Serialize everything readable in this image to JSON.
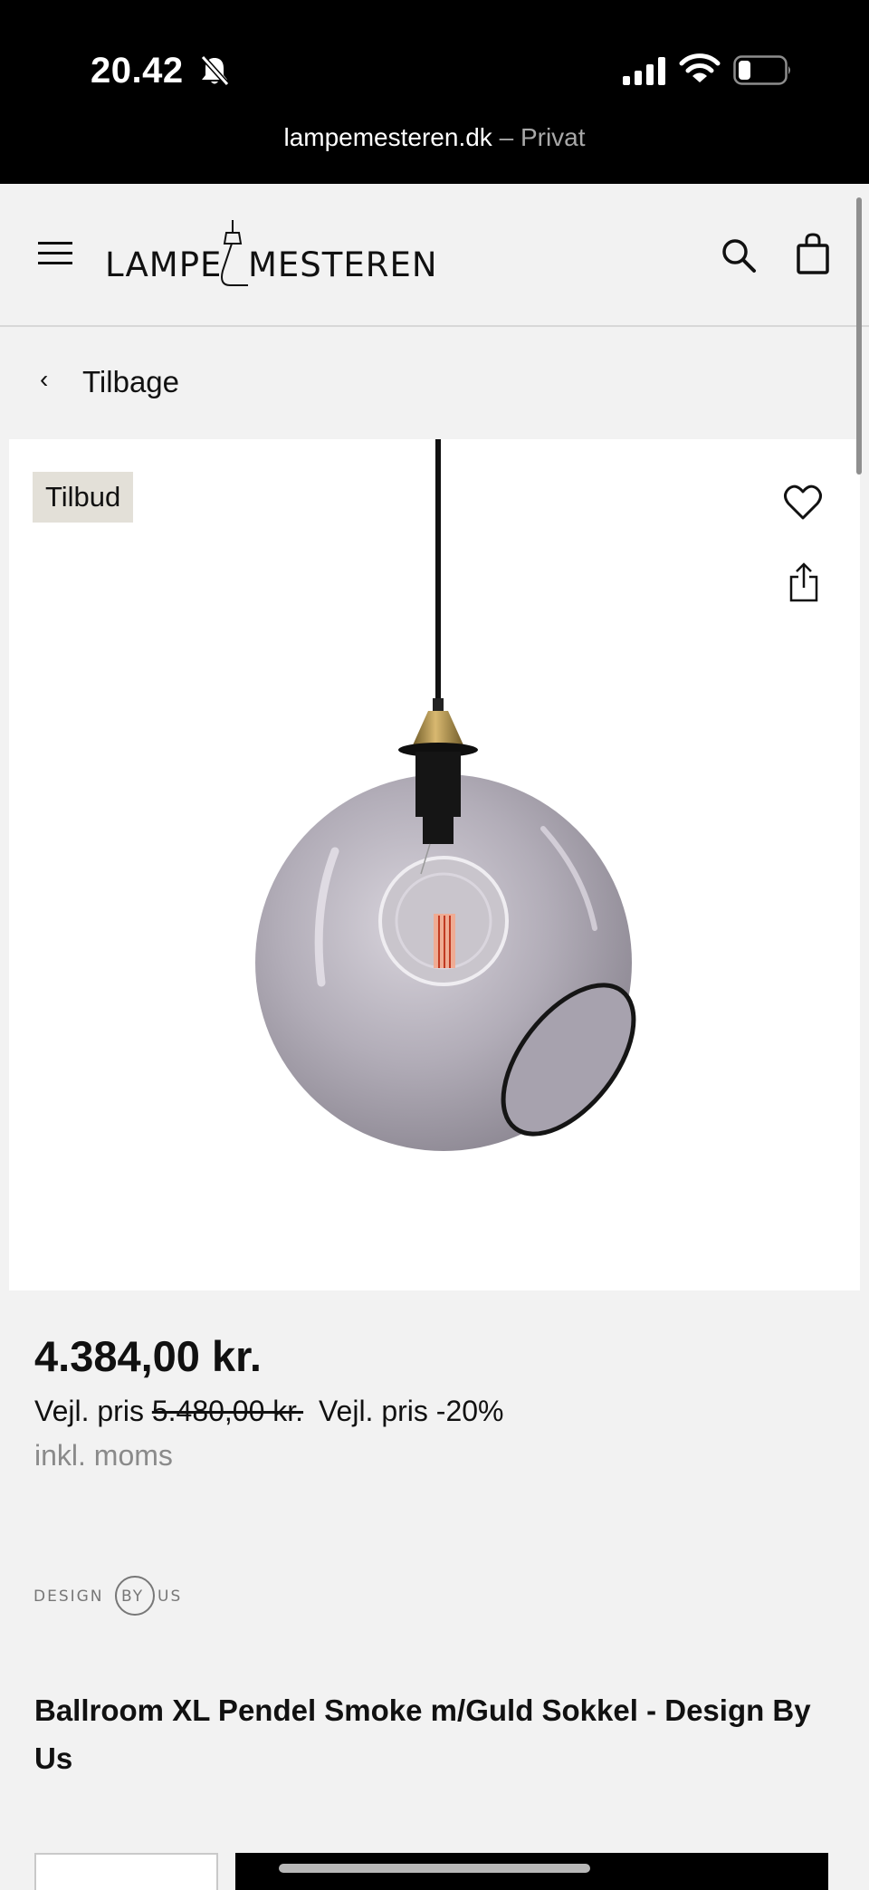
{
  "status_bar": {
    "time": "20.42",
    "icons": [
      "bell-slash-icon",
      "signal-icon",
      "wifi-icon",
      "battery-icon"
    ]
  },
  "browser": {
    "domain": "lampemesteren.dk",
    "mode": "– Privat"
  },
  "header": {
    "logo_left": "LAMPE",
    "logo_right": "MESTEREN",
    "icons": [
      "menu-icon",
      "search-icon",
      "bag-icon"
    ]
  },
  "back": {
    "label": "Tilbage",
    "icon": "chevron-left-icon"
  },
  "product": {
    "badge": "Tilbud",
    "price": "4.384,00 kr.",
    "rrp_label": "Vejl. pris",
    "rrp_value": "5.480,00 kr.",
    "discount": "Vejl. pris -20%",
    "vat_note": "inkl. moms",
    "brand_logo_text": "DESIGN BY US",
    "title": "Ballroom XL Pendel Smoke m/Guld Sokkel - Design By Us",
    "image_icons": [
      "heart-icon",
      "share-icon"
    ]
  },
  "colors": {
    "background": "#f2f2f2",
    "topbar": "#000000",
    "badge_bg": "#e3e0d8",
    "muted_text": "#8a8a8a",
    "button": "#000000"
  }
}
